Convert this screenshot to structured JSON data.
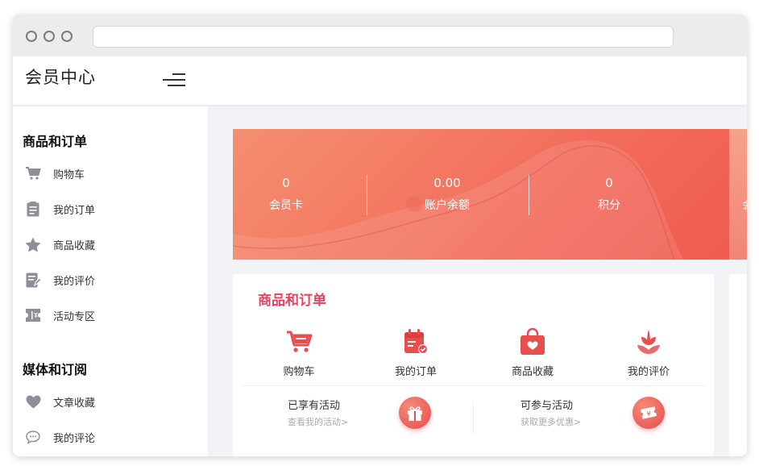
{
  "app": {
    "title": "会员中心"
  },
  "sidebar": {
    "sections": [
      {
        "title": "商品和订单",
        "items": [
          {
            "label": "购物车",
            "icon": "cart-icon"
          },
          {
            "label": "我的订单",
            "icon": "clipboard-icon"
          },
          {
            "label": "商品收藏",
            "icon": "star-icon"
          },
          {
            "label": "我的评价",
            "icon": "edit-note-icon"
          },
          {
            "label": "活动专区",
            "icon": "ticket-icon"
          }
        ]
      },
      {
        "title": "媒体和订阅",
        "items": [
          {
            "label": "文章收藏",
            "icon": "heart-icon"
          },
          {
            "label": "我的评论",
            "icon": "comment-icon"
          }
        ]
      }
    ]
  },
  "banner": {
    "stats": [
      {
        "value": "0",
        "label": "会员卡"
      },
      {
        "value": "0.00",
        "label": "账户余额"
      },
      {
        "value": "0",
        "label": "积分"
      }
    ],
    "partial_label": "会"
  },
  "orders_panel": {
    "title": "商品和订单",
    "quick_links": [
      {
        "label": "购物车",
        "icon": "cart-icon"
      },
      {
        "label": "我的订单",
        "icon": "order-calendar-icon"
      },
      {
        "label": "商品收藏",
        "icon": "favorite-bag-icon"
      },
      {
        "label": "我的评价",
        "icon": "review-flower-icon"
      }
    ],
    "promos": [
      {
        "title": "已享有活动",
        "subtitle": "查看我的活动>",
        "icon": "gift-icon"
      },
      {
        "title": "可参与活动",
        "subtitle": "获取更多优惠>",
        "icon": "coupon-icon"
      }
    ]
  },
  "colors": {
    "accent": "#e9425e",
    "banner_start": "#f58f70",
    "banner_end": "#ef5a4f",
    "icon_gray": "#8e8e96",
    "icon_red": "#ea4d4d"
  }
}
